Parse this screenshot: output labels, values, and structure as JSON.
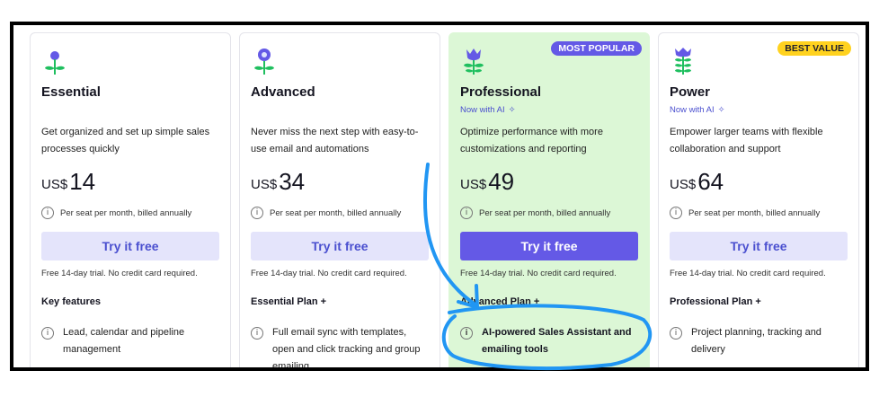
{
  "plans": [
    {
      "name": "Essential",
      "ai_label": "",
      "description": "Get organized and set up simple sales processes quickly",
      "currency": "US$",
      "price": "14",
      "billing": "Per seat per month, billed annually",
      "cta": "Try it free",
      "trial": "Free 14-day trial. No credit card required.",
      "features_heading": "Key features",
      "features": [
        "Lead, calendar and pipeline management"
      ],
      "badge": "",
      "icon": "flower-sprout-icon"
    },
    {
      "name": "Advanced",
      "ai_label": "",
      "description": "Never miss the next step with easy-to-use email and automations",
      "currency": "US$",
      "price": "34",
      "billing": "Per seat per month, billed annually",
      "cta": "Try it free",
      "trial": "Free 14-day trial. No credit card required.",
      "features_heading": "Essential Plan +",
      "features": [
        "Full email sync with templates, open and click tracking and group emailing"
      ],
      "badge": "",
      "icon": "flower-bud-icon"
    },
    {
      "name": "Professional",
      "ai_label": "Now with AI",
      "description": "Optimize performance with more customizations and reporting",
      "currency": "US$",
      "price": "49",
      "billing": "Per seat per month, billed annually",
      "cta": "Try it free",
      "trial": "Free 14-day trial. No credit card required.",
      "features_heading": "Advanced Plan +",
      "features": [
        "AI-powered Sales Assistant and emailing tools"
      ],
      "badge": "MOST POPULAR",
      "icon": "tulip-icon"
    },
    {
      "name": "Power",
      "ai_label": "Now with AI",
      "description": "Empower larger teams with flexible collaboration and support",
      "currency": "US$",
      "price": "64",
      "billing": "Per seat per month, billed annually",
      "cta": "Try it free",
      "trial": "Free 14-day trial. No credit card required.",
      "features_heading": "Professional Plan +",
      "features": [
        "Project planning, tracking and delivery"
      ],
      "badge": "BEST VALUE",
      "icon": "lavender-icon"
    }
  ],
  "colors": {
    "brand_purple": "#6459e6",
    "leaf_green": "#1fbf5f",
    "highlight_bg": "#dcf7d6",
    "badge_yellow": "#ffd21f",
    "annotation_blue": "#2196f3"
  }
}
